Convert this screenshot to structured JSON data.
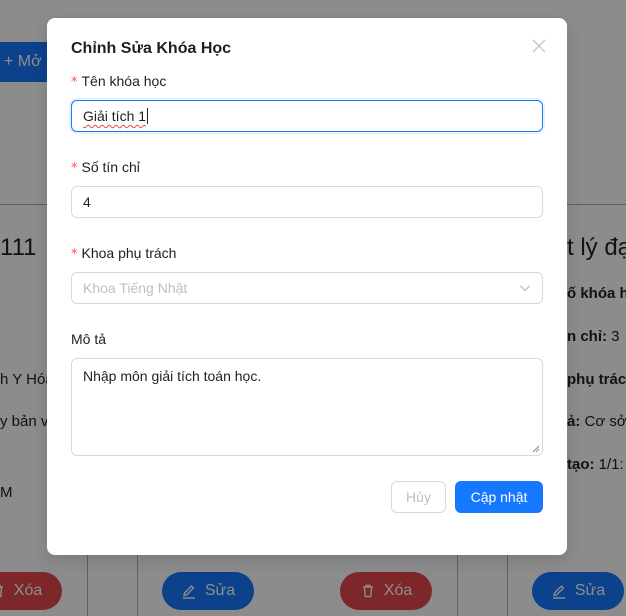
{
  "background": {
    "open_button_label": "+ Mở lớ",
    "card_texts": {
      "left_code": "111",
      "left_faculty": "h Y Hóa",
      "left_desc": "y bản và",
      "left_time": "M",
      "right_title": "t lý đạ",
      "right_code_label": "ố khóa họ",
      "right_credits_label": "n chỉ:",
      "right_credits_value": " 3",
      "right_faculty_label": "phụ trác",
      "right_desc_label": "ả:",
      "right_desc_value": " Cơ sở v",
      "right_created_label": "tạo:",
      "right_created_value": " 1/1:"
    },
    "buttons": {
      "delete_label": "Xóa",
      "edit_label": "Sửa"
    },
    "colors": {
      "primary": "#1677ff",
      "danger": "#e5484d"
    }
  },
  "modal": {
    "title": "Chỉnh Sửa Khóa Học",
    "fields": {
      "name": {
        "label": "Tên khóa học",
        "value": "Giải tích 1",
        "required": true
      },
      "credits": {
        "label": "Số tín chỉ",
        "value": "4",
        "required": true
      },
      "faculty": {
        "label": "Khoa phụ trách",
        "value": "Khoa Tiếng Nhật",
        "required": true
      },
      "description": {
        "label": "Mô tả",
        "value": "Nhập môn giải tích toán học.",
        "required": false
      }
    },
    "required_mark": "*",
    "buttons": {
      "cancel": "Hủy",
      "submit": "Cập nhật"
    }
  }
}
